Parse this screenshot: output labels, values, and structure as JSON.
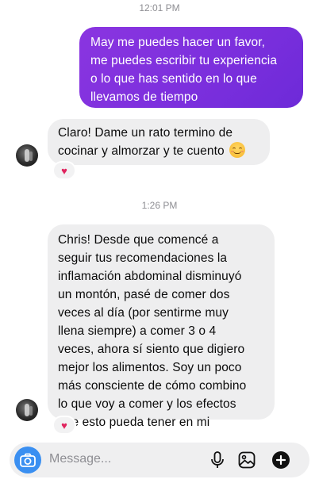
{
  "chat": {
    "timestamp_1": "12:01 PM",
    "outgoing_1": {
      "lines": [
        "May me puedes hacer un favor,",
        "me puedes escribir tu experiencia",
        "o lo que has sentido en lo que",
        "llevamos de tiempo"
      ]
    },
    "incoming_1": {
      "lines": [
        "Claro! Dame un rato termino de",
        "cocinar y almorzar y te cuento"
      ],
      "emoji": "smiling-face-emoji",
      "reaction": "♥"
    },
    "timestamp_2": "1:26 PM",
    "incoming_2": {
      "lines": [
        "Chris! Desde que comencé a",
        "seguir tus recomendaciones la",
        "inflamación abdominal disminuyó",
        "un montón, pasé de comer dos",
        "veces al día (por sentirme muy",
        "llena siempre) a comer 3 o 4",
        "veces, ahora sí siento que digiero",
        "mejor los alimentos. Soy un poco",
        "más consciente de cómo combino",
        "lo que voy a comer y los efectos",
        "que esto pueda tener en mi"
      ],
      "reaction": "♥"
    }
  },
  "composer": {
    "placeholder": "Message...",
    "icons": [
      "camera-icon",
      "microphone-icon",
      "gallery-icon",
      "plus-icon"
    ]
  },
  "colors": {
    "outgoing_bubble": "#7b2fdd",
    "incoming_bubble": "#eeeeef",
    "camera_button": "#3a8ff1",
    "reaction_heart": "#e0245e"
  }
}
